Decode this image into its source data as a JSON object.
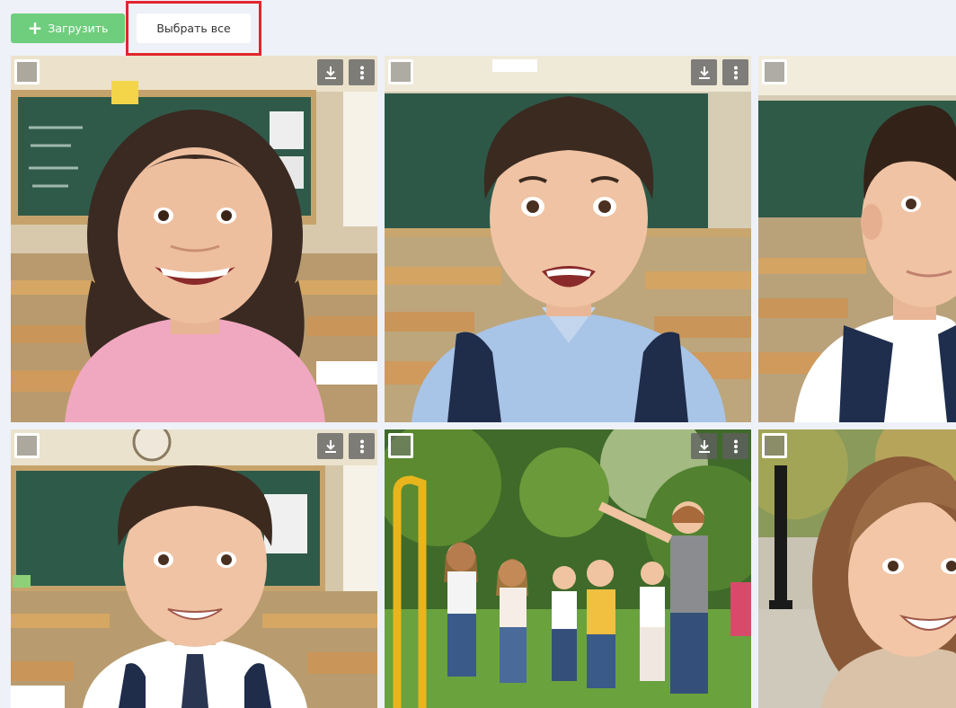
{
  "toolbar": {
    "upload_label": "Загрузить",
    "select_all_label": "Выбрать все"
  },
  "colors": {
    "upload_bg": "#6ece7d",
    "highlight": "#e2252d",
    "page_bg": "#eef1f8"
  },
  "gallery": {
    "tiles": [
      {
        "subject": "girl",
        "setting": "classroom",
        "shirt": "#f0a8c0"
      },
      {
        "subject": "boy",
        "setting": "classroom",
        "shirt": "#a8c4e6"
      },
      {
        "subject": "boy",
        "setting": "classroom",
        "shirt": "#1f2e4d"
      },
      {
        "subject": "boy",
        "setting": "classroom",
        "shirt": "#ffffff"
      },
      {
        "subject": "group",
        "setting": "park",
        "shirt": "#f2c040"
      },
      {
        "subject": "girl",
        "setting": "street",
        "shirt": "#d9c2a8"
      }
    ]
  }
}
